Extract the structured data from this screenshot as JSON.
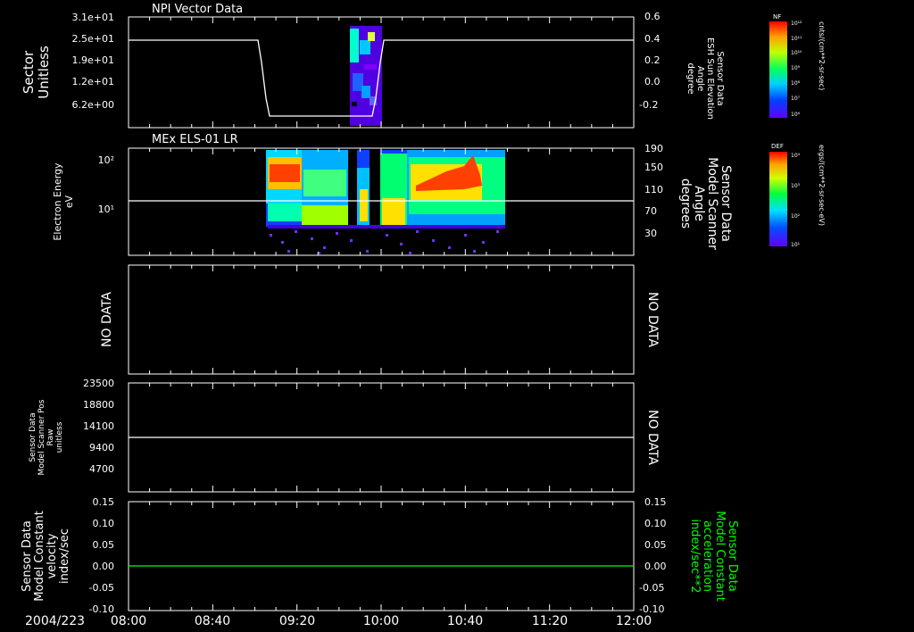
{
  "date_label": "2004/223",
  "time_ticks": [
    "08:00",
    "08:40",
    "09:20",
    "10:00",
    "10:40",
    "11:20",
    "12:00"
  ],
  "colors": {
    "frame": "#ffffff",
    "background": "#000000",
    "green_trace": "#00ff00"
  },
  "panels": [
    {
      "title": "NPI Vector Data",
      "left_label": [
        "Sector",
        "Unitless"
      ],
      "left_ticks": [
        "3.1e+01",
        "2.5e+01",
        "1.9e+01",
        "1.2e+01",
        "6.2e+00"
      ],
      "right_label": [
        "Sensor Data",
        "ESH Sun Elevation",
        "Angle",
        "degree"
      ],
      "right_ticks": [
        "0.6",
        "0.4",
        "0.2",
        "0.0",
        "-0.2"
      ],
      "colorbar": {
        "label": "NF",
        "units": "cnts/(cm**2-sr-sec)",
        "ticks": [
          "10¹²",
          "10¹¹",
          "10¹⁰",
          "10⁹",
          "10⁸",
          "10⁷",
          "10⁶"
        ]
      }
    },
    {
      "title": "MEx ELS-01 LR",
      "left_label": [
        "Electron Energy",
        "eV"
      ],
      "left_ticks": [
        "10²",
        "10¹"
      ],
      "right_label": [
        "Sensor Data",
        "Model Scanner",
        "Angle",
        "degrees"
      ],
      "right_ticks": [
        "190",
        "150",
        "110",
        "70",
        "30"
      ],
      "colorbar": {
        "label": "DEF",
        "units": "ergs/(cm**2-sr-sec-eV)",
        "ticks": [
          "10⁴",
          "10³",
          "10²",
          "10¹"
        ]
      }
    },
    {
      "left_label": [
        "NO DATA"
      ],
      "right_label": [
        "NO DATA"
      ]
    },
    {
      "left_label": [
        "Sensor Data",
        "Model Scanner Pos",
        "Raw",
        "unitless"
      ],
      "left_ticks": [
        "23500",
        "18800",
        "14100",
        "9400",
        "4700"
      ],
      "right_label": [
        "NO DATA"
      ]
    },
    {
      "left_label": [
        "Sensor Data",
        "Model Constant",
        "velocity",
        "index/sec"
      ],
      "left_ticks": [
        "0.15",
        "0.10",
        "0.05",
        "0.00",
        "-0.05",
        "-0.10"
      ],
      "right_label": [
        "Sensor Data",
        "Model Constant",
        "acceleration",
        "index/sec**2"
      ],
      "right_ticks": [
        "0.15",
        "0.10",
        "0.05",
        "0.00",
        "-0.05",
        "-0.10"
      ]
    }
  ],
  "chart_data": [
    {
      "type": "line",
      "title": "NPI Vector Data",
      "ylabel": "Sector Unitless",
      "y2label": "Sensor Data ESH Sun Elevation Angle degree",
      "y2lim": [
        -0.42,
        0.6
      ],
      "series": [
        {
          "x": [
            "08:00",
            "08:50",
            "08:54",
            "08:58",
            "09:00",
            "09:55",
            "09:57",
            "09:59",
            "10:00",
            "12:00"
          ],
          "y2": [
            0.4,
            0.4,
            0.25,
            -0.1,
            -0.35,
            -0.35,
            -0.1,
            0.25,
            0.4,
            0.4
          ]
        }
      ],
      "spectrogram_window": [
        "09:42",
        "10:00"
      ]
    },
    {
      "type": "heatmap",
      "title": "MEx ELS-01 LR",
      "ylabel": "Electron Energy eV",
      "y2label": "Sensor Data Model Scanner Angle degrees",
      "y2lim": [
        0,
        190
      ],
      "x_range": [
        "08:55",
        "10:52"
      ],
      "scanner_angle_line": 89
    },
    {
      "type": "line",
      "series": []
    },
    {
      "type": "line",
      "ylabel": "Sensor Data Model Scanner Pos Raw unitless",
      "ylim": [
        0,
        23500
      ],
      "series": [
        {
          "x": [
            "08:00",
            "12:00"
          ],
          "y": [
            11750,
            11750
          ]
        }
      ]
    },
    {
      "type": "line",
      "ylabel": "Sensor Data Model Constant velocity index/sec",
      "y2label": "Sensor Data Model Constant acceleration index/sec**2",
      "ylim": [
        -0.1,
        0.15
      ],
      "series": [
        {
          "x": [
            "08:00",
            "12:00"
          ],
          "y": [
            0.0,
            0.0
          ]
        }
      ]
    }
  ]
}
